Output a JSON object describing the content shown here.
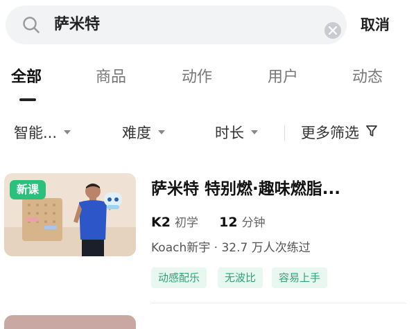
{
  "search": {
    "query": "萨米特",
    "cancel_label": "取消"
  },
  "tabs": [
    {
      "label": "全部",
      "active": true
    },
    {
      "label": "商品",
      "active": false
    },
    {
      "label": "动作",
      "active": false
    },
    {
      "label": "用户",
      "active": false
    },
    {
      "label": "动态",
      "active": false
    }
  ],
  "filters": [
    {
      "label": "智能..."
    },
    {
      "label": "难度"
    },
    {
      "label": "时长"
    },
    {
      "label": "更多筛选"
    }
  ],
  "course": {
    "badge": "新课",
    "title": "萨米特 特别燃·趣味燃脂...",
    "level_code": "K2",
    "level_text": "初学",
    "duration_value": "12",
    "duration_unit": "分钟",
    "author_line": "Koach新宇 · 32.7 万人次练过",
    "tags": [
      "动感配乐",
      "无波比",
      "容易上手"
    ]
  },
  "colors": {
    "accent_green": "#2bc07c",
    "tag_text": "#2aa57a",
    "tag_bg": "#e9f7f1"
  }
}
